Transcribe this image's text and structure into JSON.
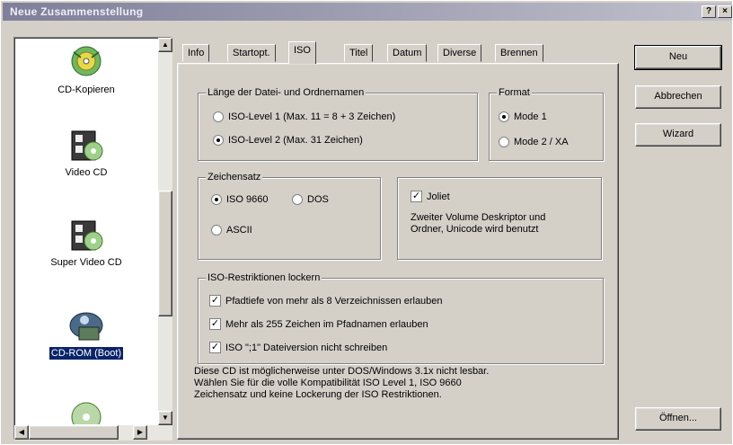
{
  "window": {
    "title": "Neue Zusammenstellung",
    "help_button": "?",
    "close_button": "×"
  },
  "project_types": [
    {
      "label": "CD-Kopieren",
      "icon": "cd-copy-icon",
      "selected": false
    },
    {
      "label": "Video CD",
      "icon": "video-cd-icon",
      "selected": false
    },
    {
      "label": "Super Video CD",
      "icon": "super-video-cd-icon",
      "selected": false
    },
    {
      "label": "CD-ROM (Boot)",
      "icon": "cd-rom-boot-icon",
      "selected": true
    }
  ],
  "tabs": [
    "Info",
    "Startopt.",
    "ISO",
    "Titel",
    "Datum",
    "Diverse",
    "Brennen"
  ],
  "active_tab": "ISO",
  "name_length": {
    "title": "Länge der Datei- und Ordnernamen",
    "options": [
      {
        "label": "ISO-Level 1 (Max. 11 = 8 + 3 Zeichen)",
        "selected": false
      },
      {
        "label": "ISO-Level 2 (Max. 31 Zeichen)",
        "selected": true
      }
    ]
  },
  "format": {
    "title": "Format",
    "options": [
      {
        "label": "Mode 1",
        "selected": true
      },
      {
        "label": "Mode 2 / XA",
        "selected": false
      }
    ]
  },
  "charset": {
    "title": "Zeichensatz",
    "options": [
      {
        "label": "ISO 9660",
        "selected": true
      },
      {
        "label": "DOS",
        "selected": false
      },
      {
        "label": "ASCII",
        "selected": false
      }
    ]
  },
  "joliet": {
    "label": "Joliet",
    "checked": true,
    "description_line1": "Zweiter Volume Deskriptor und",
    "description_line2": "Ordner, Unicode wird benutzt"
  },
  "iso_restrictions": {
    "title": "ISO-Restriktionen lockern",
    "options": [
      {
        "label": "Pfadtiefe von mehr als 8 Verzeichnissen erlauben",
        "checked": true
      },
      {
        "label": "Mehr als 255 Zeichen im Pfadnamen erlauben",
        "checked": true
      },
      {
        "label": "ISO \";1\" Dateiversion nicht schreiben",
        "checked": true
      }
    ]
  },
  "footer_note": {
    "line1": "Diese CD ist möglicherweise unter DOS/Windows 3.1x nicht lesbar.",
    "line2": "Wählen Sie für die volle Kompatibilität ISO Level 1, ISO 9660",
    "line3": "Zeichensatz und keine Lockerung der ISO Restriktionen."
  },
  "buttons": {
    "new": "Neu",
    "cancel": "Abbrechen",
    "wizard": "Wizard",
    "open": "Öffnen..."
  },
  "colors": {
    "selection": "#0a246a",
    "face": "#d4d0c8"
  }
}
